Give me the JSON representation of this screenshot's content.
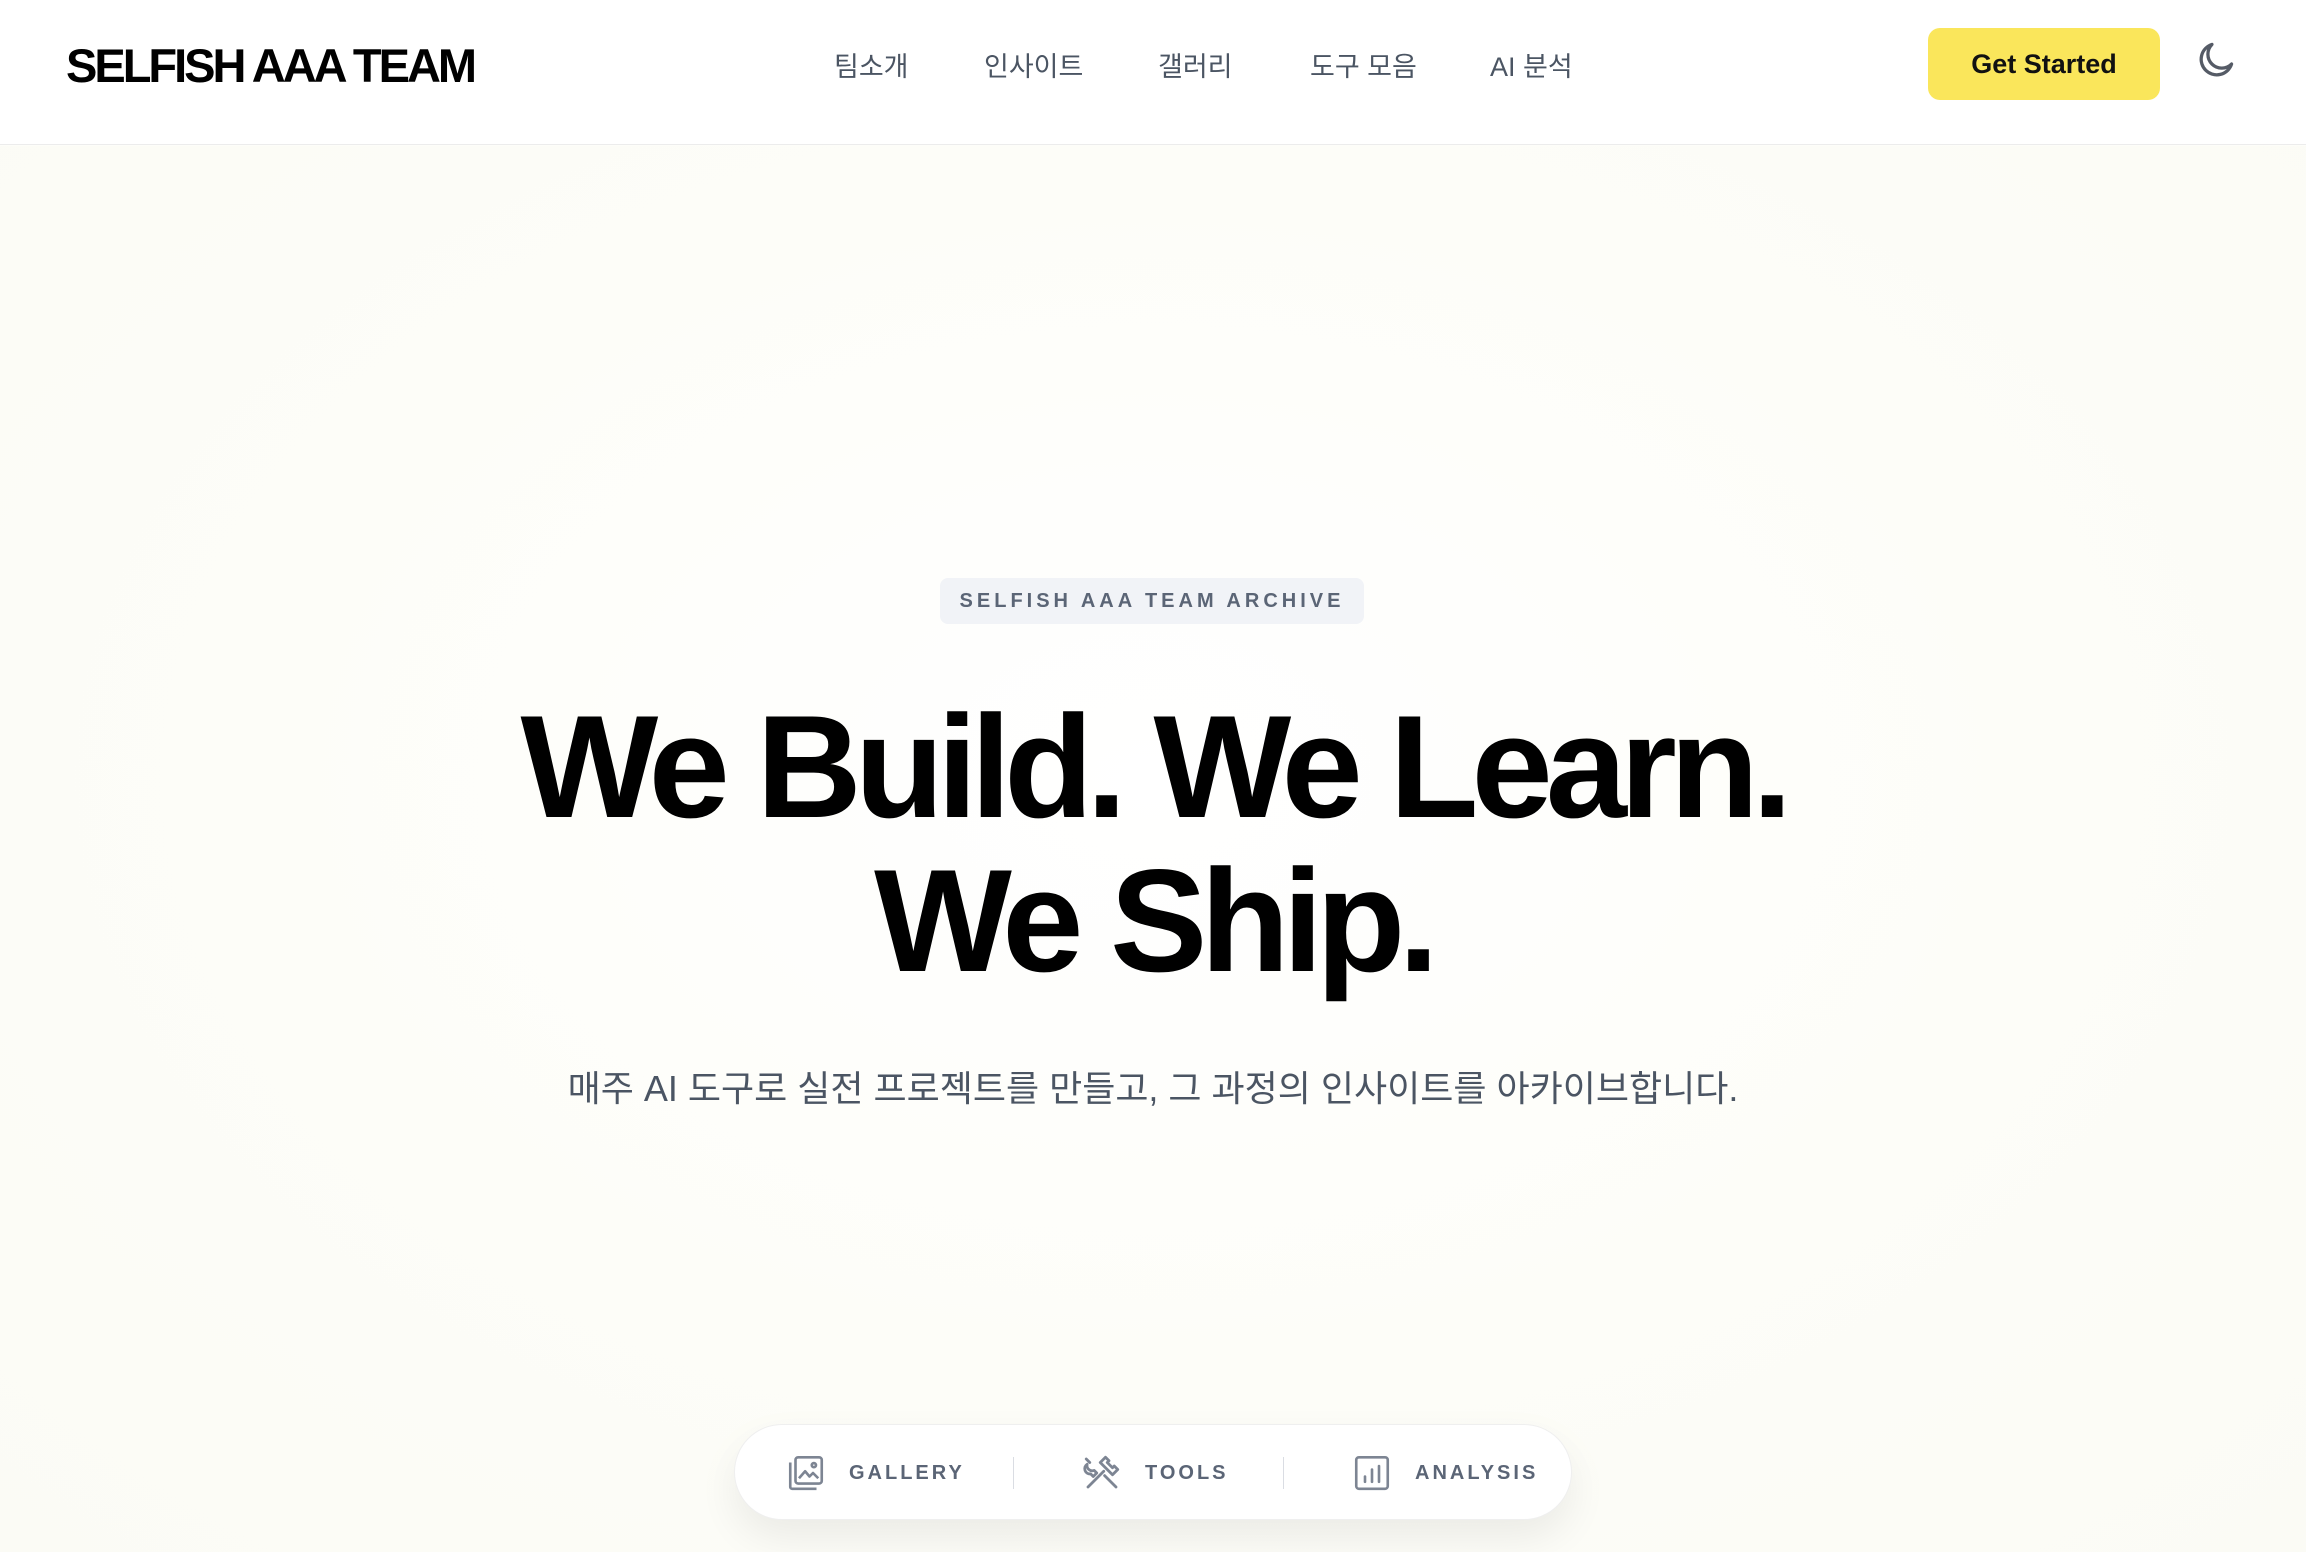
{
  "header": {
    "logo": "SELFISH AAA TEAM",
    "nav": [
      "팀소개",
      "인사이트",
      "갤러리",
      "도구 모음",
      "AI 분석"
    ],
    "cta_label": "Get Started",
    "theme_icon": "moon-icon"
  },
  "hero": {
    "badge": "SELFISH AAA TEAM ARCHIVE",
    "headline_line1": "We Build. We Learn.",
    "headline_line2": "We Ship.",
    "subtitle": "매주 AI 도구로 실전 프로젝트를 만들고, 그 과정의 인사이트를 아카이브합니다."
  },
  "quick_nav": [
    {
      "label": "GALLERY",
      "icon": "gallery-icon"
    },
    {
      "label": "TOOLS",
      "icon": "tools-icon"
    },
    {
      "label": "ANALYSIS",
      "icon": "analysis-icon"
    }
  ],
  "colors": {
    "accent": "#fae65b",
    "text_muted": "#4b5563",
    "label": "#5b6576"
  }
}
